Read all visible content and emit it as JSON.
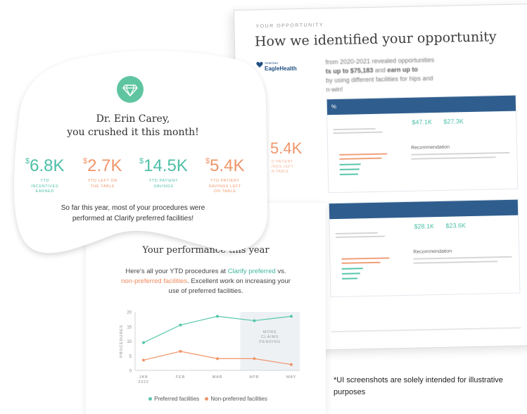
{
  "report": {
    "eyebrow": "YOUR OPPORTUNITY",
    "title": "How we identified your opportunity",
    "intro_1": "from 2020-2021 revealed opportunities",
    "intro_2a": "ts up to $75,183",
    "intro_2b": " and ",
    "intro_2c": "earn up to",
    "intro_3": "by using different facilities for hips and",
    "intro_4": "n-win!",
    "section_1": {
      "bar_label": "%",
      "stat_1": "$47.1K",
      "stat_2": "$27.3K",
      "heading": "Recommendation"
    },
    "section_2": {
      "bar_label": "",
      "stat_1": "$28.1K",
      "stat_2": "$23.6K",
      "heading": "Recommendation"
    }
  },
  "bubble": {
    "logo_small": "American",
    "logo_name": "EagleHealth",
    "greeting_line_1": "Dr. Erin Carey,",
    "greeting_line_2": "you crushed it this month!",
    "stats": [
      {
        "value": "6.8K",
        "currency": "$",
        "label_1": "YTD",
        "label_2": "INCENTIVES",
        "label_3": "EARNED",
        "color": "#4dbfa7"
      },
      {
        "value": "2.7K",
        "currency": "$",
        "label_1": "YTD LEFT ON",
        "label_2": "THE TABLE",
        "label_3": "",
        "color": "#f0956a"
      },
      {
        "value": "14.5K",
        "currency": "$",
        "label_1": "YTD PATIENT",
        "label_2": "SAVINGS",
        "label_3": "",
        "color": "#4dbfa7"
      },
      {
        "value": "5.4K",
        "currency": "$",
        "label_1": "YTD PATIENT",
        "label_2": "SAVINGS LEFT",
        "label_3": "ON TABLE",
        "color": "#f0956a"
      }
    ],
    "note": "So far this year, most of your procedures were performed at Clarify preferred facilities!",
    "peek_value": "5.4K",
    "peek_label_1": "D PATIENT",
    "peek_label_2": "INGS LEFT",
    "peek_label_3": "N TABLE"
  },
  "performance": {
    "title": "Your performance this year",
    "desc_1": "Here's all your YTD procedures at ",
    "desc_pref": "Clarify preferred",
    "desc_2": " vs.",
    "desc_non": "non-preferred facilities",
    "desc_3": ". Excellent work on increasing your use of preferred facilities."
  },
  "chart_data": {
    "type": "line",
    "x": [
      "JAN 2022",
      "FEB",
      "MAR",
      "APR",
      "MAY"
    ],
    "ylabel": "PROCEDURES",
    "ylim": [
      0,
      20
    ],
    "yticks": [
      0,
      5,
      10,
      15,
      20
    ],
    "series": [
      {
        "name": "Preferred facilities",
        "values": [
          9.5,
          15.5,
          18.5,
          17,
          18.5
        ],
        "color": "#56c6ab"
      },
      {
        "name": "Non-preferred facilities",
        "values": [
          3.5,
          6.5,
          4,
          4,
          2
        ],
        "color": "#f0956a"
      }
    ],
    "annotation": [
      "MORE",
      "CLAIMS",
      "PENDING"
    ],
    "pending_from_index": 3
  },
  "disclaimer": "*UI screenshots are solely intended for illustrative purposes"
}
